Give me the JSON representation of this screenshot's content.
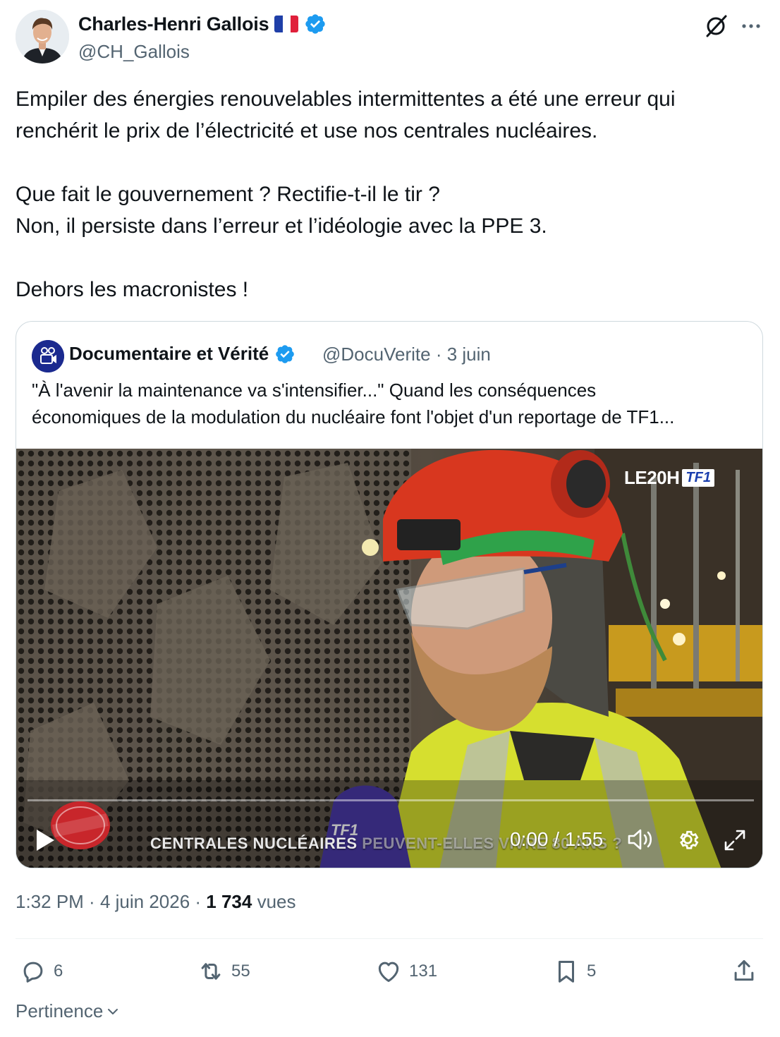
{
  "author": {
    "name": "Charles-Henri Gallois",
    "handle": "@CH_Gallois",
    "flag": "french-flag",
    "verified": true
  },
  "tweet": {
    "lines": [
      "Empiler des énergies renouvelables intermittentes a été une erreur qui",
      "renchérit le prix de l’électricité et use nos centrales nucléaires.",
      "Que fait le gouvernement ? Rectifie-t-il le tir ?",
      "Non, il persiste dans l’erreur et l’idéologie avec la PPE 3.",
      "Dehors les macronistes !"
    ]
  },
  "quote": {
    "name": "Documentaire et Vérité",
    "handle": "@DocuVerite",
    "date": "3 juin",
    "lines": [
      "\"À l'avenir la maintenance va s'intensifier...\" Quand les conséquences",
      "économiques de la modulation du nucléaire font l'objet d'un reportage de TF1..."
    ],
    "video": {
      "channel_logo_text": "LE20H",
      "channel_logo_tf1": "TF1",
      "mic_label": "TF1",
      "caption_main": "CENTRALES NUCLÉAIRES",
      "caption_rest": "PEUVENT-ELLES VIVRE 80 ANS ?",
      "overlay_logo": "DÉFENSE D'ENTRER",
      "timecode": "0:00 / 1:55",
      "progress": 0
    }
  },
  "timestamp": {
    "time": "1:32 PM",
    "sep1": " · ",
    "date": "4 juin 2026",
    "sep2": " · ",
    "views": "1 734",
    "views_label": "vues"
  },
  "actions": {
    "replies": "6",
    "reposts": "55",
    "likes": "131",
    "bookmarks": "5"
  },
  "sort": {
    "label": "Pertinence"
  },
  "colors": {
    "text": "#0f1419",
    "secondary": "#536471",
    "verified": "#1d9bf0",
    "border": "#cfd9de"
  }
}
